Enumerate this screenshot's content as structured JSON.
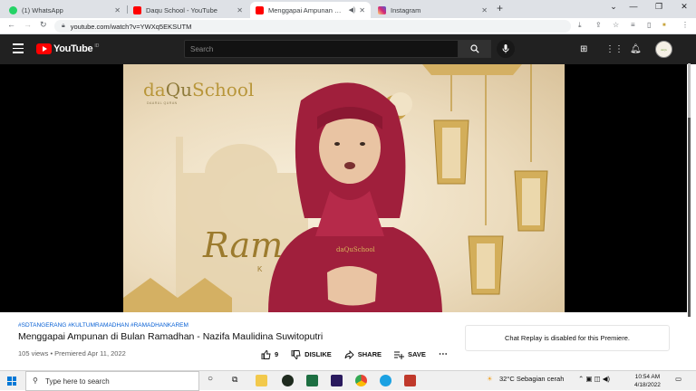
{
  "browser": {
    "tabs": [
      {
        "label": "(1) WhatsApp",
        "icon": "whatsapp-icon",
        "color": "#25d366",
        "active": false
      },
      {
        "label": "Daqu School - YouTube",
        "icon": "youtube-icon",
        "color": "#ff0000",
        "active": false
      },
      {
        "label": "Menggapai Ampunan di Bul",
        "icon": "youtube-icon",
        "color": "#ff0000",
        "active": true
      },
      {
        "label": "Instagram",
        "icon": "instagram-icon",
        "color": "#d6249f",
        "active": false
      }
    ],
    "url": "youtube.com/watch?v=YWXq5EKSUTM"
  },
  "youtube": {
    "logo_text": "YouTube",
    "country_code": "ID",
    "search_placeholder": "Search",
    "avatar_text": "daQu"
  },
  "video": {
    "brand_prefix": "da",
    "brand_q": "Qu",
    "brand_suffix": "School",
    "brand_sub": "DAARUL QURAN",
    "overlay_word": "Ram",
    "overlay_sub": "K"
  },
  "info": {
    "hashtags": "#SDTANGERANG #KULTUMRAMADHAN #RAMADHANKAREM",
    "title": "Menggapai Ampunan di Bulan Ramadhan - Nazifa Maulidina Suwitoputri",
    "views": "105 views",
    "premiered": "Premiered Apr 11, 2022",
    "like_count": "9",
    "dislike_label": "DISLIKE",
    "share_label": "SHARE",
    "save_label": "SAVE",
    "chat_replay": "Chat Replay is disabled for this Premiere."
  },
  "taskbar": {
    "search_placeholder": "Type here to search",
    "weather": "32°C  Sebagian cerah",
    "time": "10:54 AM",
    "date": "4/18/2022"
  },
  "colors": {
    "yt_header": "#212121",
    "yt_red": "#ff0000",
    "link_blue": "#065fd4",
    "gold": "#b8963a",
    "hijab": "#a01f3c"
  }
}
